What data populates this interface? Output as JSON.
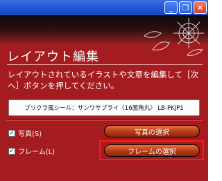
{
  "window": {
    "controls": [
      {
        "icon": "minimize-icon",
        "glyph": "_"
      },
      {
        "icon": "restore-icon",
        "glyph": "❐"
      },
      {
        "icon": "close-icon",
        "glyph": "✕"
      }
    ]
  },
  "page": {
    "title": "レイアウト編集",
    "description": "レイアウトされているイラストや文章を編集して［次へ］ボタンを押してください。"
  },
  "paper": {
    "label": "プリクラ風シール：サンワサプライ〈16面角丸〉 LB-PKJP1"
  },
  "options": [
    {
      "label": "写真(S)",
      "checked": true,
      "button_label": "写真の選択"
    },
    {
      "label": "フレーム(L)",
      "checked": true,
      "button_label": "フレームの選択",
      "highlighted": true
    }
  ],
  "colors": {
    "background": "#a51c20",
    "titlebar": "#1f55d6",
    "button": "#c8461e",
    "highlight": "#ff1a1a"
  }
}
